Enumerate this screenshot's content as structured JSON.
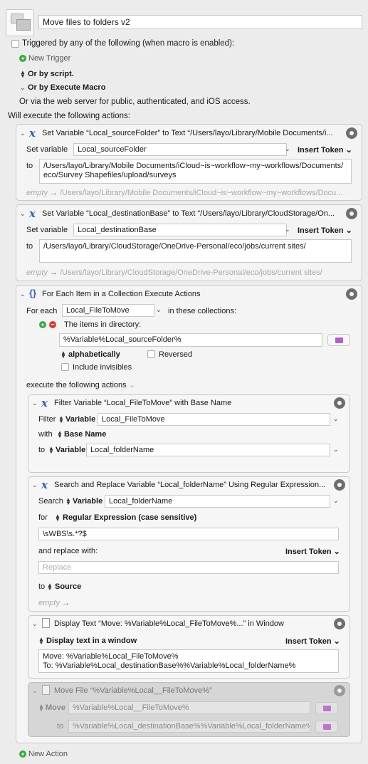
{
  "macro": {
    "name": "Move files to folders v2",
    "triggered_label": "Triggered by any of the following (when macro is enabled):",
    "new_trigger": "New Trigger",
    "or_by_script": "Or by script.",
    "or_by_execute": "Or by Execute Macro",
    "web_server": "Or via the web server for public, authenticated, and iOS access.",
    "will_execute": "Will execute the following actions:",
    "new_action": "New Action"
  },
  "a1": {
    "title": "Set Variable “Local_sourceFolder” to Text “/Users/layo/Library/Mobile Documents/i...",
    "set_variable_label": "Set variable",
    "var": "Local_sourceFolder",
    "insert_token": "Insert Token",
    "to": "to",
    "text_line1": "/Users/layo/Library/Mobile Documents/iCloud~is~workflow~my~workflows/Documents/",
    "text_line2": "eco/Survey Shapefiles/upload/surveys",
    "empty": "empty",
    "preview": "/Users/layo/Library/Mobile Documents/iCloud~is~workflow~my~workflows/Docu..."
  },
  "a2": {
    "title": "Set Variable “Local_destinationBase” to Text “/Users/layo/Library/CloudStorage/On...",
    "set_variable_label": "Set variable",
    "var": "Local_destinationBase",
    "insert_token": "Insert Token",
    "to": "to",
    "text_line1": "/Users/layo/Library/CloudStorage/OneDrive-Personal/eco/jobs/current sites/",
    "empty": "empty",
    "preview": "/Users/layo/Library/CloudStorage/OneDrive-Personal/eco/jobs/current sites/"
  },
  "a3": {
    "title": "For Each Item in a Collection Execute Actions",
    "for_each": "For each",
    "var": "Local_FileToMove",
    "in_collections": "in these collections:",
    "items_in_dir": "The items in directory:",
    "dir_value": "%Variable%Local_sourceFolder%",
    "alphabetically": "alphabetically",
    "reversed": "Reversed",
    "include_invisibles": "Include invisibles",
    "execute_following": "execute the following actions"
  },
  "a4": {
    "title": "Filter Variable “Local_FileToMove” with Base Name",
    "filter": "Filter",
    "variable": "Variable",
    "var": "Local_FileToMove",
    "with": "with",
    "base_name": "Base Name",
    "to": "to",
    "to_var": "Local_folderName"
  },
  "a5": {
    "title": "Search and Replace Variable “Local_folderName” Using Regular Expression...",
    "search": "Search",
    "variable": "Variable",
    "var": "Local_folderName",
    "for": "for",
    "regex_label": "Regular Expression (case sensitive)",
    "regex_value": "\\sWBS\\s.*?$",
    "and_replace": "and replace with:",
    "insert_token": "Insert Token",
    "replace_placeholder": "Replace",
    "to": "to",
    "source": "Source",
    "empty": "empty"
  },
  "a6": {
    "title": "Display Text “Move: %Variable%Local_FileToMove%...” in Window",
    "mode": "Display text in a window",
    "insert_token": "Insert Token",
    "line1": "Move: %Variable%Local_FileToMove%",
    "line2": "To: %Variable%Local_destinationBase%%Variable%Local_folderName%"
  },
  "a7": {
    "title": "Move File “%Variable%Local__FileToMove%”",
    "move": "Move",
    "move_value": "%Variable%Local__FileToMove%",
    "to": "to",
    "to_value": "%Variable%Local_destinationBase%%Variable%Local_folderName%"
  }
}
